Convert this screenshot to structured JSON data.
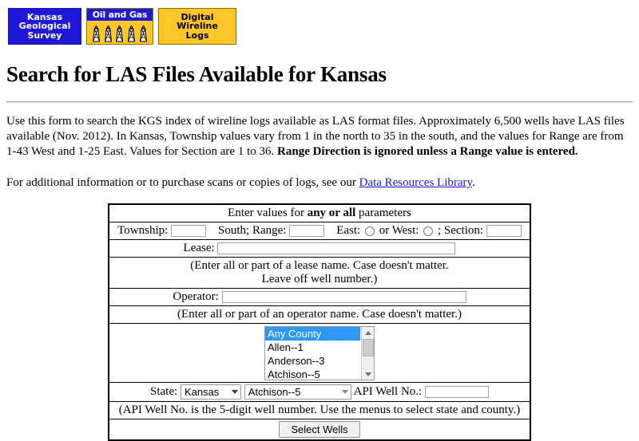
{
  "banners": {
    "kgs": {
      "name": "Kansas Geological Survey",
      "lines": [
        "Kansas",
        "Geological",
        "Survey"
      ],
      "bg": "#2018d8",
      "fg": "#ffffff"
    },
    "oil_and_gas": {
      "name": "Oil and Gas",
      "label": "Oil and Gas",
      "bg": "#ffc629",
      "label_bg": "#2018d8",
      "derrick_count": 5
    },
    "digital_wireline_logs": {
      "name": "Digital Wireline Logs",
      "lines": [
        "Digital",
        "Wireline",
        "Logs"
      ],
      "bg": "#ffc629",
      "fg": "#000000"
    }
  },
  "page_title": "Search for LAS Files Available for Kansas",
  "intro": {
    "part1": "Use this form to search the KGS index of wireline logs available as LAS format files. Approximately 6,500 wells have LAS files available (Nov. 2012). In Kansas, Township values vary from 1 in the north to 35 in the south, and the values for Range are from 1-43 West and 1-25 East. Values for Section are 1 to 36. ",
    "bold": "Range Direction is ignored unless a Range value is entered.",
    "part2_before_link": "For additional information or to purchase scans or copies of logs, see our ",
    "link_text": "Data Resources Library",
    "part2_after_link": ".",
    "link_color": "#1a1ae0"
  },
  "form": {
    "header_before": "Enter values for ",
    "header_bold": "any or all",
    "header_after": " parameters",
    "township_label": "Township:",
    "township_value": "",
    "range_label": "South; Range:",
    "range_value": "",
    "east_label": "East:",
    "east_selected": false,
    "or_west_label": "or West:",
    "west_selected": false,
    "section_label": "; Section:",
    "section_value": "",
    "lease_label": "Lease:",
    "lease_value": "",
    "lease_help_line1": "(Enter all or part of a lease name. Case doesn't matter.",
    "lease_help_line2": "Leave off well number.)",
    "operator_label": "Operator:",
    "operator_value": "",
    "operator_help": "(Enter all or part of an operator name. Case doesn't matter.)",
    "county_list": [
      {
        "label": "Any County",
        "selected": true
      },
      {
        "label": "Allen--1",
        "selected": false
      },
      {
        "label": "Anderson--3",
        "selected": false
      },
      {
        "label": "Atchison--5",
        "selected": false
      }
    ],
    "county_selected_highlight": "#2f97f5",
    "state_label": "State:",
    "state_value": "Kansas",
    "county_menu_value": "Atchison--5",
    "api_label": "API Well No.:",
    "api_value": "",
    "api_help": "(API Well No. is the 5-digit well number. Use the menus to select state and county.)",
    "submit_label": "Select Wells"
  }
}
